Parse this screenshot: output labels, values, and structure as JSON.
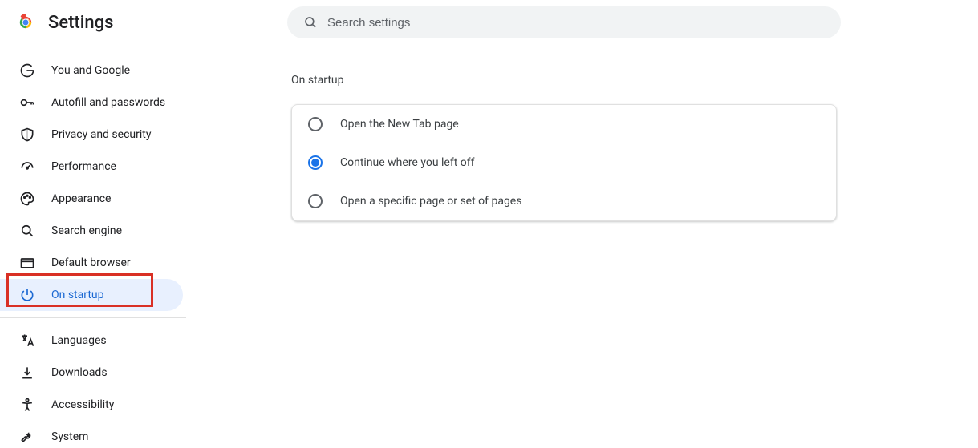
{
  "header": {
    "title": "Settings"
  },
  "search": {
    "placeholder": "Search settings"
  },
  "sidebar": {
    "items": [
      {
        "label": "You and Google"
      },
      {
        "label": "Autofill and passwords"
      },
      {
        "label": "Privacy and security"
      },
      {
        "label": "Performance"
      },
      {
        "label": "Appearance"
      },
      {
        "label": "Search engine"
      },
      {
        "label": "Default browser"
      },
      {
        "label": "On startup"
      },
      {
        "label": "Languages"
      },
      {
        "label": "Downloads"
      },
      {
        "label": "Accessibility"
      },
      {
        "label": "System"
      }
    ],
    "selected_index": 7,
    "highlighted_index": 7
  },
  "main": {
    "section_title": "On startup",
    "radio_options": [
      {
        "label": "Open the New Tab page",
        "checked": false
      },
      {
        "label": "Continue where you left off",
        "checked": true
      },
      {
        "label": "Open a specific page or set of pages",
        "checked": false
      }
    ]
  }
}
